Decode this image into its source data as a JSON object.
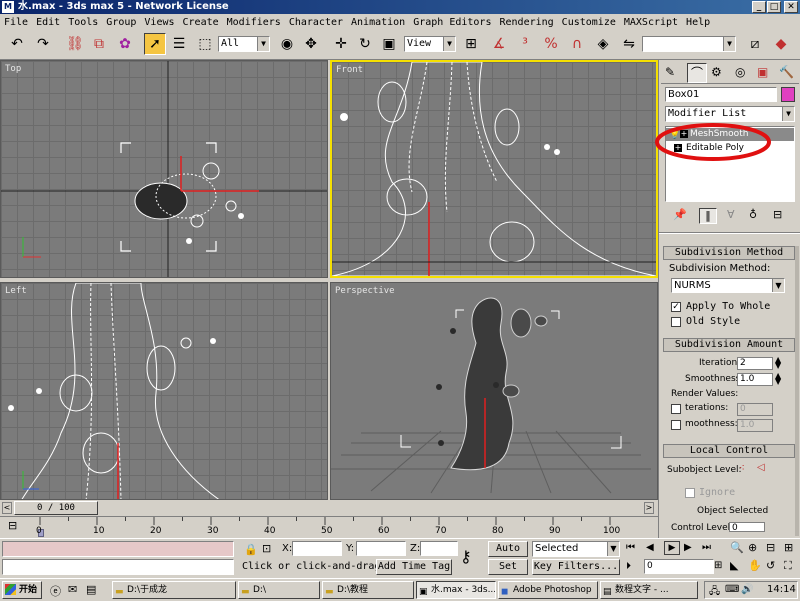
{
  "window": {
    "title": "水.max - 3ds max 5 - Network License",
    "app_icon": "3ds-max-icon",
    "min": "_",
    "max": "□",
    "close": "✕"
  },
  "menu": [
    "File",
    "Edit",
    "Tools",
    "Group",
    "Views",
    "Create",
    "Modifiers",
    "Character",
    "Animation",
    "Graph Editors",
    "Rendering",
    "Customize",
    "MAXScript",
    "Help"
  ],
  "toolbar": {
    "selection_filter": "All",
    "ref_coord": "View",
    "named_selection": ""
  },
  "viewports": {
    "top": {
      "label": "Top"
    },
    "front": {
      "label": "Front"
    },
    "left": {
      "label": "Left"
    },
    "perspective": {
      "label": "Perspective"
    }
  },
  "command_panel": {
    "object_name": "Box01",
    "object_color": "#e040c0",
    "modifier_list": "Modifier List",
    "stack": [
      "MeshSmooth",
      "Editable Poly"
    ],
    "subdivision_method": {
      "title": "Subdivision Method",
      "label": "Subdivision Method:",
      "value": "NURMS",
      "apply_to_whole": "Apply To Whole",
      "apply_to_whole_checked": true,
      "old_style": "Old Style",
      "old_style_checked": false
    },
    "subdivision_amount": {
      "title": "Subdivision Amount",
      "iterations_label": "Iterations:",
      "iterations": "2",
      "smoothness_label": "Smoothness:",
      "smoothness": "1.0",
      "render_values": "Render Values:",
      "r_iterations_label": "terations:",
      "r_iterations": "0",
      "r_smoothness_label": "moothness:",
      "r_smoothness": "1.0"
    },
    "local_control": {
      "title": "Local Control",
      "subobject_level": "Subobject Level:",
      "ignore": "Ignore",
      "object_selected": "Object Selected",
      "control_level": "Control Level:",
      "control_level_value": "0"
    }
  },
  "timeline": {
    "frame_display": "0 / 100",
    "ticks": [
      "0",
      "10",
      "20",
      "30",
      "40",
      "50",
      "60",
      "70",
      "80",
      "90",
      "100"
    ]
  },
  "status": {
    "x_label": "X:",
    "y_label": "Y:",
    "z_label": "Z:",
    "prompt": "Click or click-and-drag",
    "add_time_tag": "Add Time Tag",
    "auto_key": "Auto Key",
    "set_key": "Set Key",
    "key_mode": "Selected",
    "key_filters": "Key Filters...",
    "frame": "0"
  },
  "taskbar": {
    "start": "开始",
    "tasks": [
      "D:\\于成龙",
      "D:\\",
      "D:\\教程",
      "水.max - 3ds...",
      "Adobe Photoshop",
      "数程文字 - ..."
    ],
    "clock": "14:14"
  }
}
